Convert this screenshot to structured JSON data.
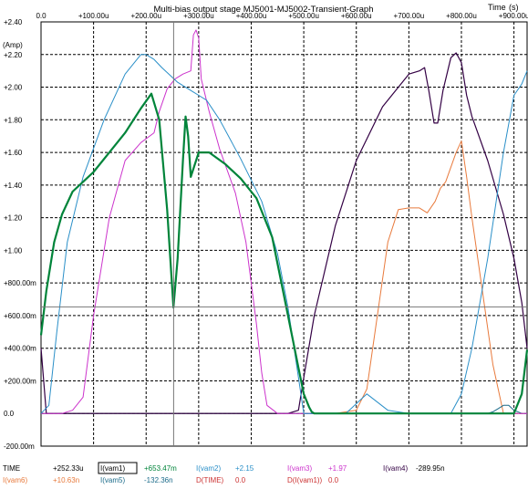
{
  "chart_data": {
    "type": "line",
    "title": "Multi-bias output stage MJ5001-MJ5002-Transient-Graph",
    "xunit_label": "Time",
    "xunit": "(s)",
    "yunit": "(Amp)",
    "xlim": [
      0,
      925
    ],
    "ylim": [
      -0.2,
      2.4
    ],
    "x_ticks": [
      {
        "v": 0,
        "label": "0.0"
      },
      {
        "v": 100,
        "label": "+100.00u"
      },
      {
        "v": 200,
        "label": "+200.00u"
      },
      {
        "v": 300,
        "label": "+300.00u"
      },
      {
        "v": 400,
        "label": "+400.00u"
      },
      {
        "v": 500,
        "label": "+500.00u"
      },
      {
        "v": 600,
        "label": "+600.00u"
      },
      {
        "v": 700,
        "label": "+700.00u"
      },
      {
        "v": 800,
        "label": "+800.00u"
      },
      {
        "v": 900,
        "label": "+900.00u"
      }
    ],
    "y_ticks": [
      {
        "v": 2.4,
        "label": "+2.40"
      },
      {
        "v": 2.2,
        "label": "+2.20"
      },
      {
        "v": 2.0,
        "label": "+2.00"
      },
      {
        "v": 1.8,
        "label": "+1.80"
      },
      {
        "v": 1.6,
        "label": "+1.60"
      },
      {
        "v": 1.4,
        "label": "+1.40"
      },
      {
        "v": 1.2,
        "label": "+1.20"
      },
      {
        "v": 1.0,
        "label": "+1.00"
      },
      {
        "v": 0.8,
        "label": "+800.00m"
      },
      {
        "v": 0.6,
        "label": "+600.00m"
      },
      {
        "v": 0.4,
        "label": "+400.00m"
      },
      {
        "v": 0.2,
        "label": "+200.00m"
      },
      {
        "v": 0,
        "label": "0.0"
      },
      {
        "v": -0.2,
        "label": "-200.00m"
      }
    ],
    "cursor_x": 252.33,
    "cursor_y": 0.6535,
    "series": [
      {
        "name": "I(vam1)",
        "color": "#00843a",
        "width": 2.2,
        "x": [
          0,
          10,
          25,
          40,
          60,
          80,
          100,
          130,
          160,
          190,
          210,
          225,
          240,
          252,
          260,
          270,
          275,
          280,
          285,
          290,
          300,
          320,
          350,
          380,
          410,
          440,
          470,
          490,
          500,
          510,
          515,
          520,
          530,
          560,
          600,
          700,
          800,
          900,
          915,
          925
        ],
        "y": [
          0.48,
          0.75,
          1.05,
          1.22,
          1.36,
          1.42,
          1.48,
          1.6,
          1.72,
          1.87,
          1.96,
          1.8,
          1.25,
          0.65,
          0.95,
          1.55,
          1.82,
          1.7,
          1.45,
          1.5,
          1.6,
          1.6,
          1.53,
          1.44,
          1.32,
          1.08,
          0.6,
          0.28,
          0.12,
          0.04,
          0.01,
          0.0,
          0.0,
          0.0,
          0.0,
          0.0,
          0.0,
          0.0,
          0.12,
          0.39
        ]
      },
      {
        "name": "I(vam2)",
        "color": "#2a8fc8",
        "width": 1,
        "x": [
          0,
          15,
          30,
          50,
          80,
          120,
          160,
          190,
          200,
          215,
          230,
          260,
          290,
          300,
          315,
          340,
          380,
          420,
          450,
          470,
          490,
          500,
          520,
          550,
          580,
          620,
          660,
          700,
          730,
          760,
          780,
          800,
          820,
          850,
          880,
          900,
          915,
          925
        ],
        "y": [
          0.0,
          0.05,
          0.5,
          1.05,
          1.45,
          1.8,
          2.08,
          2.2,
          2.2,
          2.17,
          2.12,
          2.03,
          1.97,
          1.95,
          1.92,
          1.8,
          1.56,
          1.3,
          0.98,
          0.65,
          0.22,
          0.0,
          0.0,
          0.0,
          0.0,
          0.12,
          0.02,
          0.0,
          0.0,
          0.0,
          0.0,
          0.12,
          0.4,
          0.95,
          1.6,
          1.95,
          2.02,
          2.1
        ]
      },
      {
        "name": "I(vam3)",
        "color": "#cc33cc",
        "width": 1,
        "x": [
          0,
          40,
          60,
          80,
          100,
          130,
          160,
          190,
          215,
          225,
          240,
          255,
          270,
          285,
          290,
          295,
          300,
          305,
          320,
          340,
          370,
          390,
          410,
          420,
          430,
          450,
          470,
          490,
          500,
          525,
          560,
          600,
          700,
          800,
          900,
          925
        ],
        "y": [
          0.0,
          0.0,
          0.02,
          0.1,
          0.6,
          1.2,
          1.55,
          1.66,
          1.72,
          1.85,
          1.99,
          2.05,
          2.08,
          2.1,
          2.32,
          2.35,
          2.3,
          2.05,
          1.85,
          1.62,
          1.35,
          1.05,
          0.55,
          0.25,
          0.05,
          0.0,
          0.0,
          0.0,
          0.0,
          0.0,
          0.0,
          0.0,
          0.0,
          0.0,
          0.0,
          0.0
        ]
      },
      {
        "name": "I(vam4)",
        "color": "#330044",
        "width": 1.2,
        "x": [
          0,
          10,
          20,
          30,
          50,
          100,
          200,
          300,
          400,
          450,
          470,
          490,
          500,
          520,
          560,
          600,
          650,
          700,
          720,
          730,
          738,
          748,
          755,
          765,
          780,
          790,
          800,
          810,
          820,
          850,
          880,
          900,
          915,
          925
        ],
        "y": [
          0.4,
          0.0,
          0.0,
          0.0,
          0.0,
          0.0,
          0.0,
          0.0,
          0.0,
          0.0,
          0.0,
          0.02,
          0.22,
          0.6,
          1.15,
          1.55,
          1.88,
          2.08,
          2.1,
          2.12,
          1.98,
          1.78,
          1.78,
          1.98,
          2.18,
          2.21,
          2.15,
          1.95,
          1.82,
          1.55,
          1.22,
          0.95,
          0.68,
          0.4
        ]
      },
      {
        "name": "I(vam5)",
        "color": "#1b6b8a",
        "width": 1,
        "x": [
          0,
          100,
          200,
          300,
          400,
          470,
          500,
          600,
          700,
          750,
          800,
          850,
          860,
          870,
          880,
          890,
          900,
          915,
          925
        ],
        "y": [
          0.0,
          0.0,
          0.0,
          0.0,
          0.0,
          0.0,
          0.0,
          0.0,
          0.0,
          0.0,
          0.0,
          0.0,
          0.01,
          0.03,
          0.05,
          0.05,
          0.02,
          0.0,
          0.0
        ]
      },
      {
        "name": "I(vam6)",
        "color": "#e87a3c",
        "width": 1,
        "x": [
          0,
          100,
          200,
          300,
          400,
          500,
          560,
          600,
          620,
          640,
          660,
          680,
          700,
          720,
          735,
          750,
          760,
          770,
          790,
          800,
          810,
          820,
          840,
          860,
          880,
          900,
          925
        ],
        "y": [
          0.0,
          0.0,
          0.0,
          0.0,
          0.0,
          0.0,
          0.0,
          0.02,
          0.15,
          0.6,
          1.05,
          1.25,
          1.26,
          1.26,
          1.23,
          1.3,
          1.38,
          1.42,
          1.6,
          1.67,
          1.45,
          1.2,
          0.75,
          0.3,
          0.0,
          0.0,
          0.0
        ]
      }
    ]
  },
  "readout": {
    "row1": [
      {
        "label": "TIME",
        "value": "+252.33u",
        "label_color": "#000000",
        "value_color": "#000000",
        "boxed": false
      },
      {
        "label": "I(vam1)",
        "value": "+653.47m",
        "label_color": "#000000",
        "value_color": "#00843a",
        "boxed": true
      },
      {
        "label": "I(vam2)",
        "value": "+2.15",
        "label_color": "#2a8fc8",
        "value_color": "#2a8fc8",
        "boxed": false
      },
      {
        "label": "I(vam3)",
        "value": "+1.97",
        "label_color": "#cc33cc",
        "value_color": "#cc33cc",
        "boxed": false
      },
      {
        "label": "I(vam4)",
        "value": "-289.95n",
        "label_color": "#330044",
        "value_color": "#000000",
        "boxed": false
      }
    ],
    "row2": [
      {
        "label": "I(vam6)",
        "value": "+10.63n",
        "label_color": "#e87a3c",
        "value_color": "#e87a3c",
        "boxed": false
      },
      {
        "label": "I(vam5)",
        "value": "-132.36n",
        "label_color": "#1b6b8a",
        "value_color": "#1b6b8a",
        "boxed": false
      },
      {
        "label": "D(TIME)",
        "value": "0.0",
        "label_color": "#cc3333",
        "value_color": "#cc3333",
        "boxed": false
      },
      {
        "label": "D(I(vam1))",
        "value": "0.0",
        "label_color": "#cc3333",
        "value_color": "#cc3333",
        "boxed": false
      }
    ]
  }
}
